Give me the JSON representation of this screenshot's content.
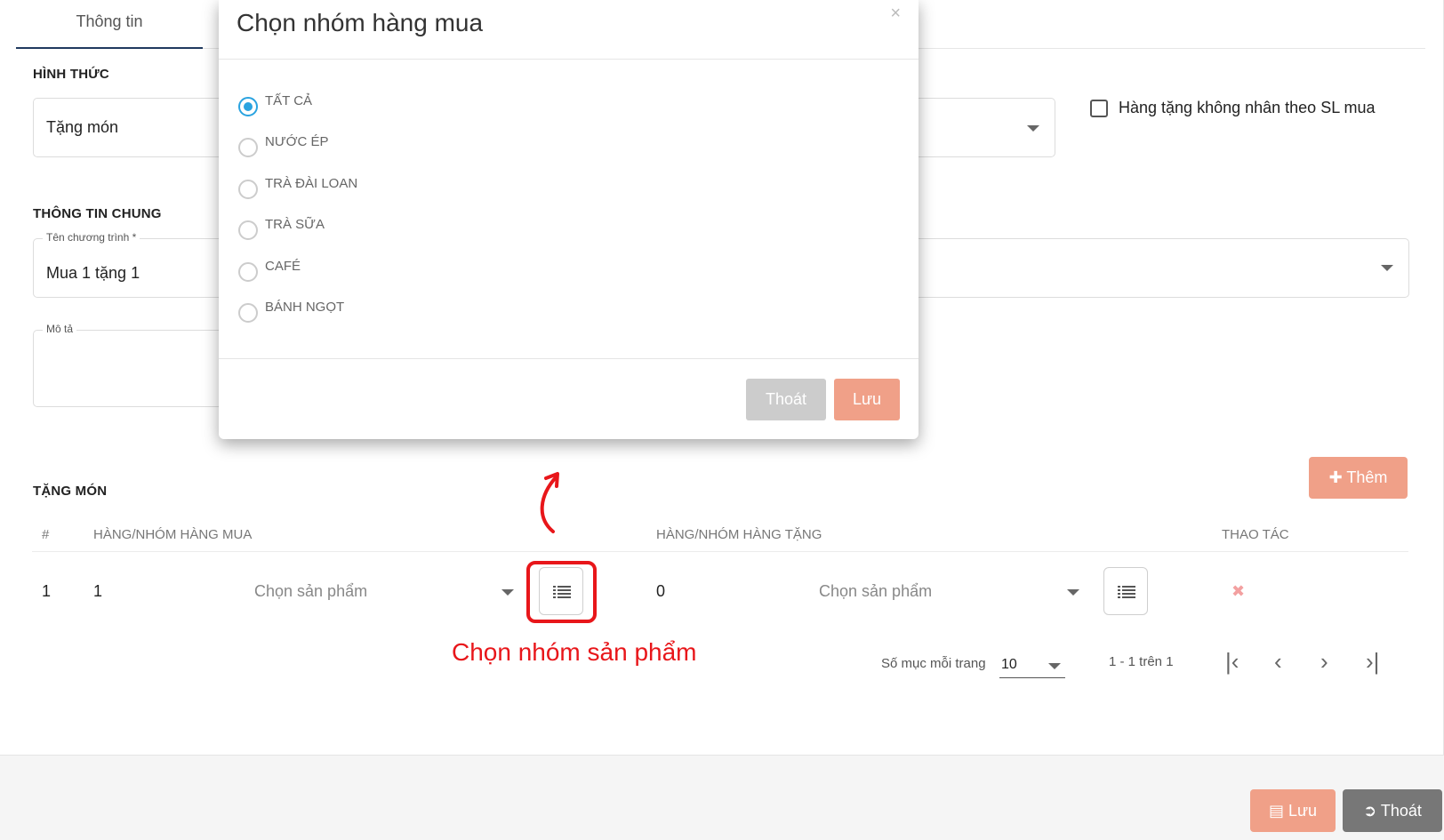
{
  "tabs": [
    {
      "label": "Thông tin"
    }
  ],
  "hinh_thuc": {
    "title": "HÌNH THỨC",
    "value": "Tặng món",
    "checkbox_label": "Hàng tặng không nhân theo SL mua"
  },
  "thong_tin_chung": {
    "title": "THÔNG TIN CHUNG",
    "ten_label": "Tên chương trình *",
    "ten_value": "Mua 1 tặng 1",
    "mo_ta_label": "Mô tả"
  },
  "tang_mon": {
    "title": "TẶNG MÓN",
    "add_button": "Thêm",
    "headers": [
      "#",
      "HÀNG/NHÓM HÀNG MUA",
      "HÀNG/NHÓM HÀNG TẶNG",
      "THAO TÁC"
    ],
    "rows": [
      {
        "index": "1",
        "buy_qty": "1",
        "buy_placeholder": "Chọn sản phẩm",
        "gift_qty": "0",
        "gift_placeholder": "Chọn sản phẩm",
        "delete": "✖"
      }
    ]
  },
  "annotation": {
    "text": "Chọn nhóm sản phẩm",
    "color": "#e8161a"
  },
  "pager": {
    "per_page_label": "Số mục mỗi trang",
    "per_page_value": "10",
    "range_text": "1 - 1 trên 1"
  },
  "footer": {
    "save_label": "Lưu",
    "exit_label": "Thoát"
  },
  "modal": {
    "title": "Chọn nhóm hàng mua",
    "close": "×",
    "options": [
      {
        "label": "TẤT CẢ",
        "selected": true
      },
      {
        "label": "NƯỚC ÉP",
        "selected": false
      },
      {
        "label": "TRÀ ĐÀI LOAN",
        "selected": false
      },
      {
        "label": "TRÀ SỮA",
        "selected": false
      },
      {
        "label": "CAFÉ",
        "selected": false
      },
      {
        "label": "BÁNH NGỌT",
        "selected": false
      }
    ],
    "exit_label": "Thoát",
    "save_label": "Lưu"
  },
  "colors": {
    "accent": "#f0a088",
    "radio": "#2aa3e0",
    "tab_underline": "#1f3a5f"
  }
}
